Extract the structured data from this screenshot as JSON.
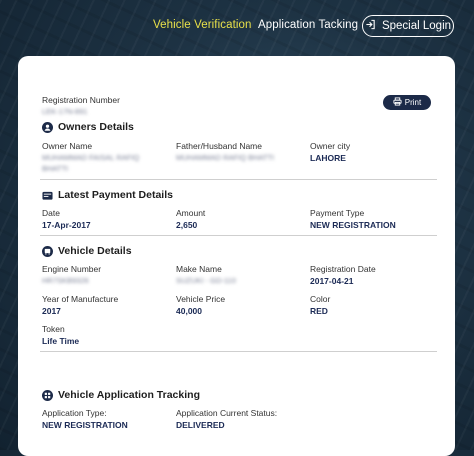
{
  "nav": {
    "vehicle_verification": "Vehicle Verification",
    "application_tracking": "Application Tacking",
    "special_login": "Special Login"
  },
  "colors": {
    "accent_yellow": "#e8e04a",
    "navy": "#1c2a48"
  },
  "print_label": "Print",
  "registration": {
    "label": "Registration Number",
    "value": "LEK-17N-891"
  },
  "owners": {
    "title": "Owners Details",
    "owner_name_label": "Owner Name",
    "owner_name_value": "MUHAMMAD FAISAL RAFIQ BHATTI",
    "father_label": "Father/Husband Name",
    "father_value": "MUHAMMAD RAFIQ BHATTI",
    "city_label": "Owner city",
    "city_value": "LAHORE"
  },
  "payment": {
    "title": "Latest Payment Details",
    "date_label": "Date",
    "date_value": "17-Apr-2017",
    "amount_label": "Amount",
    "amount_value": "2,650",
    "type_label": "Payment Type",
    "type_value": "NEW REGISTRATION"
  },
  "vehicle": {
    "title": "Vehicle Details",
    "engine_label": "Engine Number",
    "engine_value": "HR7SKB9326",
    "make_label": "Make Name",
    "make_value": "SUZUKI - GD-110",
    "regdate_label": "Registration Date",
    "regdate_value": "2017-04-21",
    "year_label": "Year of Manufacture",
    "year_value": "2017",
    "price_label": "Vehicle Price",
    "price_value": "40,000",
    "color_label": "Color",
    "color_value": "RED",
    "token_label": "Token",
    "token_value": "Life Time"
  },
  "tracking": {
    "title": "Vehicle Application Tracking",
    "type_label": "Application Type:",
    "type_value": "NEW REGISTRATION",
    "status_label": "Application Current Status:",
    "status_value": "DELIVERED"
  }
}
